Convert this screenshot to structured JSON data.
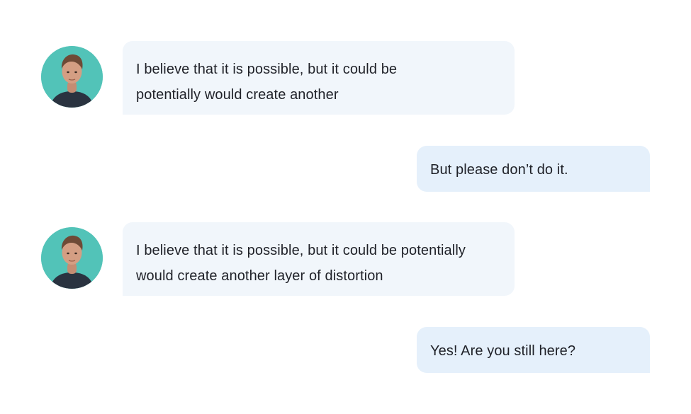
{
  "conversation": {
    "messages": [
      {
        "sender": "contact",
        "avatar_icon": "person-photo-icon",
        "text": "I believe that it is possible, but it could be potentially would create another"
      },
      {
        "sender": "me",
        "text": "But please don’t do it."
      },
      {
        "sender": "contact",
        "avatar_icon": "person-photo-icon",
        "text": "I believe that it is possible, but it could be potentially would create another layer of distortion"
      },
      {
        "sender": "me",
        "text": "Yes! Are you still here?"
      }
    ]
  },
  "colors": {
    "avatar_background": "#52c3b8",
    "incoming_bubble": "#f1f6fb",
    "outgoing_bubble": "#e5f0fb",
    "text": "#1f2128"
  }
}
